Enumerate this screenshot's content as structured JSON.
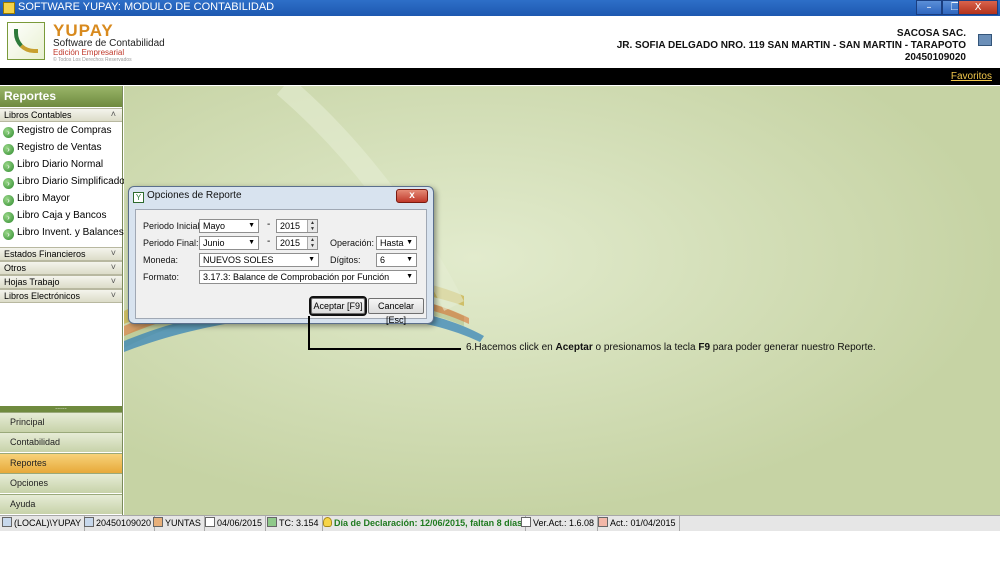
{
  "window": {
    "title": "SOFTWARE YUPAY: MODULO DE CONTABILIDAD",
    "minimize": "–",
    "restore": "❐",
    "close": "X"
  },
  "header": {
    "logo_title": "YUPAY",
    "logo_sub1": "Software de Contabilidad",
    "logo_sub2": "Edición Empresarial",
    "logo_sub3": "© Todos Los Derechos Reservados",
    "company_name": "SACOSA SAC.",
    "company_address": "JR. SOFIA DELGADO NRO. 119 SAN MARTIN - SAN MARTIN - TARAPOTO",
    "company_ruc": "20450109020",
    "favoritos": "Favoritos"
  },
  "sidebar": {
    "title": "Reportes",
    "groups": [
      {
        "label": "Libros Contables",
        "chevron": "˄"
      },
      {
        "label": "Estados Financieros",
        "chevron": "˅"
      },
      {
        "label": "Otros",
        "chevron": "˅"
      },
      {
        "label": "Hojas Trabajo",
        "chevron": "˅"
      },
      {
        "label": "Libros Electrónicos",
        "chevron": "˅"
      }
    ],
    "items": [
      {
        "label": "Registro de Compras"
      },
      {
        "label": "Registro de Ventas"
      },
      {
        "label": "Libro Diario Normal"
      },
      {
        "label": "Libro Diario Simplificado"
      },
      {
        "label": "Libro Mayor"
      },
      {
        "label": "Libro Caja y Bancos"
      },
      {
        "label": "Libro Invent. y Balances"
      }
    ],
    "splitter": "......",
    "nav": [
      {
        "label": "Principal"
      },
      {
        "label": "Contabilidad"
      },
      {
        "label": "Reportes"
      },
      {
        "label": "Opciones"
      },
      {
        "label": "Ayuda"
      }
    ]
  },
  "dialog": {
    "title": "Opciones de Reporte",
    "close": "x",
    "periodo_inicial_label": "Periodo Inicial:",
    "periodo_inicial_mes": "Mayo",
    "periodo_inicial_anio": "2015",
    "periodo_final_label": "Periodo Final:",
    "periodo_final_mes": "Junio",
    "periodo_final_anio": "2015",
    "dash": "-",
    "operacion_label": "Operación:",
    "operacion_value": "Hasta",
    "moneda_label": "Moneda:",
    "moneda_value": "NUEVOS SOLES",
    "digitos_label": "Dígitos:",
    "digitos_value": "6",
    "formato_label": "Formato:",
    "formato_value": "3.17.3: Balance de Comprobación por Función",
    "aceptar": "Aceptar [F9]",
    "cancelar": "Cancelar [Esc]"
  },
  "callout": {
    "prefix": "6.Hacemos click en ",
    "b1": "Aceptar",
    "mid": " o presionamos la tecla ",
    "b2": "F9",
    "suffix": " para poder generar nuestro Reporte."
  },
  "statusbar": {
    "server": "(LOCAL)\\YUPAY",
    "ruc": "20450109020",
    "user": "YUNTAS",
    "date": "04/06/2015",
    "tc": "TC: 3.154",
    "declaracion": "Día de Declaración: 12/06/2015, faltan 8 días",
    "version": "Ver.Act.: 1.6.08",
    "act": "Act.: 01/04/2015"
  },
  "colors": {
    "sidebar_header": "#6f8a3e",
    "main_bg": "#ccd8ac",
    "active_nav": "#e7a93a",
    "status_green": "#1f7a1f"
  }
}
